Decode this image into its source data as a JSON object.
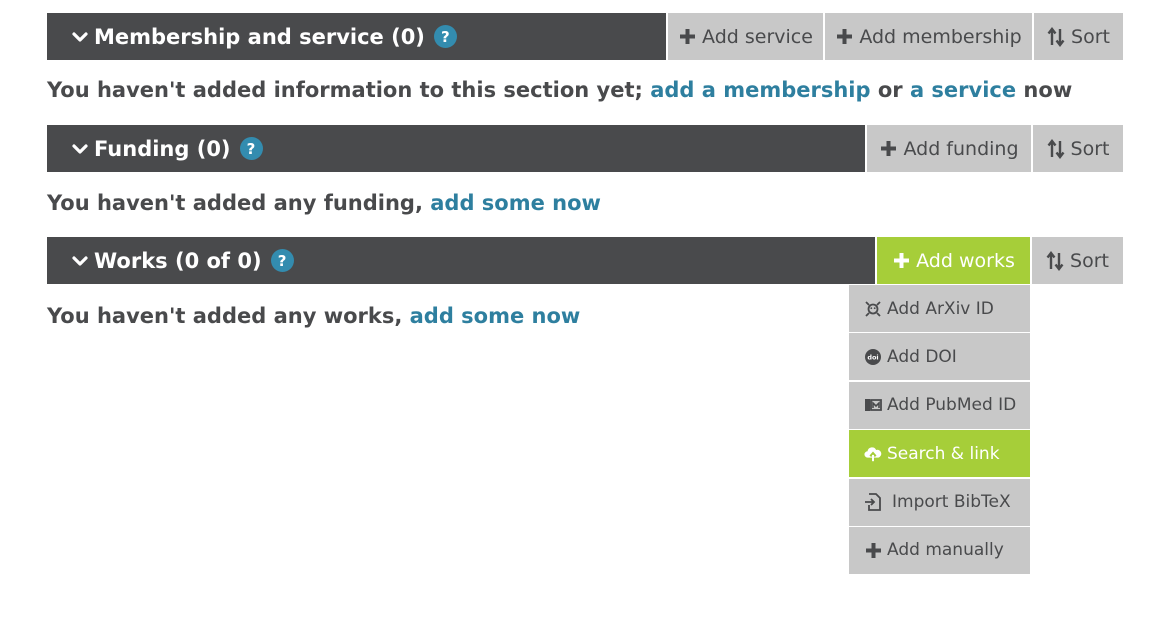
{
  "membership": {
    "title": "Membership and service (0)",
    "help": "?",
    "add_service_label": "Add service",
    "add_membership_label": "Add membership",
    "sort_label": "Sort",
    "empty_prefix": "You haven't added information to this section yet; ",
    "empty_link1": "add a membership",
    "empty_mid": " or ",
    "empty_link2": "a service",
    "empty_suffix": " now"
  },
  "funding": {
    "title": "Funding (0)",
    "help": "?",
    "add_funding_label": "Add funding",
    "sort_label": "Sort",
    "empty_prefix": "You haven't added any funding, ",
    "empty_link": "add some now"
  },
  "works": {
    "title": "Works (0 of 0)",
    "help": "?",
    "add_works_label": "Add works",
    "sort_label": "Sort",
    "empty_prefix": "You haven't added any works, ",
    "empty_link": "add some now",
    "menu": [
      {
        "label": "Add ArXiv ID",
        "icon": "arxiv-icon"
      },
      {
        "label": "Add DOI",
        "icon": "doi-icon"
      },
      {
        "label": "Add PubMed ID",
        "icon": "pubmed-icon"
      },
      {
        "label": "Search & link",
        "icon": "cloud-upload-icon",
        "active": true
      },
      {
        "label": "Import BibTeX",
        "icon": "import-file-icon"
      },
      {
        "label": "Add manually",
        "icon": "plus-icon"
      }
    ]
  },
  "colors": {
    "bar_background": "#494a4c",
    "button_gray": "#c8c8c8",
    "accent_green": "#a6ce39",
    "link_blue": "#2e7f9f",
    "help_blue": "#338caf"
  }
}
